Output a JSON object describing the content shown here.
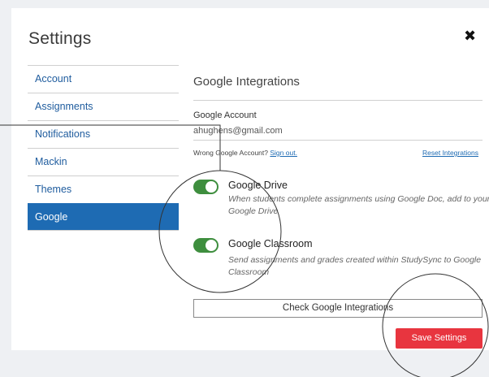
{
  "modal": {
    "title": "Settings",
    "close_icon": "close-x-icon"
  },
  "sidebar": {
    "items": [
      {
        "label": "Account",
        "active": false
      },
      {
        "label": "Assignments",
        "active": false
      },
      {
        "label": "Notifications",
        "active": false
      },
      {
        "label": "Mackin",
        "active": false
      },
      {
        "label": "Themes",
        "active": false
      },
      {
        "label": "Google",
        "active": true
      }
    ]
  },
  "google": {
    "section_title": "Google Integrations",
    "account_label": "Google Account",
    "account_value": "ahughens@gmail.com",
    "wrong_account_text": "Wrong Google Account?",
    "sign_out_link": "Sign out.",
    "reset_link": "Reset Integrations",
    "options": [
      {
        "title": "Google Drive",
        "description": "When students complete assignments using Google Doc, add to your Google Drive",
        "enabled": true
      },
      {
        "title": "Google Classroom",
        "description": "Send assignments and grades created within StudySync to Google Classroom",
        "enabled": true
      }
    ],
    "check_button": "Check Google Integrations",
    "save_button": "Save Settings"
  },
  "colors": {
    "primary": "#1e6bb3",
    "toggle_on": "#3e8e3e",
    "save": "#e8353f"
  }
}
